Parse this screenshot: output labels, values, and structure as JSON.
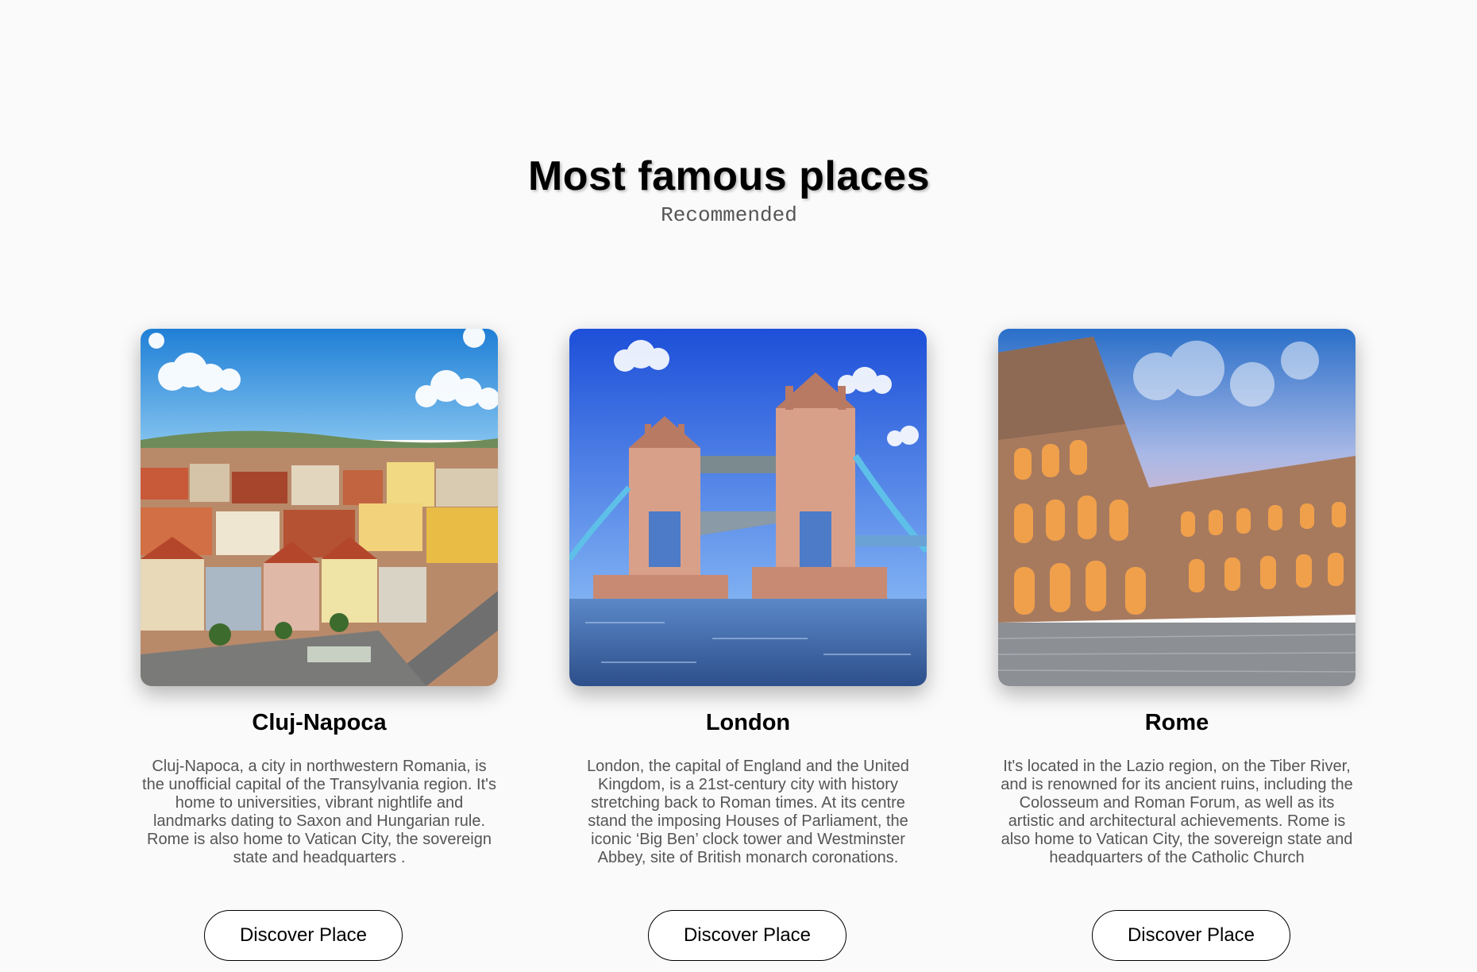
{
  "header": {
    "title": "Most famous places",
    "subtitle": "Recommended"
  },
  "places": [
    {
      "name": "Cluj-Napoca",
      "image": "cluj-napoca-photo",
      "description": "Cluj-Napoca, a city in northwestern Romania, is the unofficial capital of the Transylvania region. It's home to universities, vibrant nightlife and landmarks dating to Saxon and Hungarian rule. Rome is also home to Vatican City, the sovereign state and headquarters .",
      "button_label": "Discover Place"
    },
    {
      "name": "London",
      "image": "london-tower-bridge-photo",
      "description": "London, the capital of England and the United Kingdom, is a 21st-century city with history stretching back to Roman times. At its centre stand the imposing Houses of Parliament, the iconic ‘Big Ben’ clock tower and Westminster Abbey, site of British monarch coronations.",
      "button_label": "Discover Place"
    },
    {
      "name": "Rome",
      "image": "rome-colosseum-photo",
      "description": "It's located in the Lazio region, on the Tiber River, and is renowned for its ancient ruins, including the Colosseum and Roman Forum, as well as its artistic and architectural achievements. Rome is also home to Vatican City, the sovereign state and headquarters of the Catholic Church",
      "button_label": "Discover Place"
    }
  ],
  "colors": {
    "background": "#fafafa",
    "text": "#000000",
    "muted_text": "#555555"
  }
}
